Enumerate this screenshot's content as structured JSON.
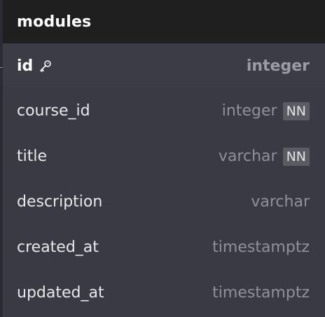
{
  "table": {
    "name": "modules",
    "columns": [
      {
        "name": "id",
        "type": "integer",
        "badge": null,
        "icon": "key-icon"
      },
      {
        "name": "course_id",
        "type": "integer",
        "badge": "NN"
      },
      {
        "name": "title",
        "type": "varchar",
        "badge": "NN"
      },
      {
        "name": "description",
        "type": "varchar",
        "badge": null
      },
      {
        "name": "created_at",
        "type": "timestamptz",
        "badge": null
      },
      {
        "name": "updated_at",
        "type": "timestamptz",
        "badge": null
      }
    ]
  },
  "colors": {
    "header_bg": "#1f1f1f",
    "body_bg": "#393a44",
    "badge_bg": "#5a5b63"
  }
}
